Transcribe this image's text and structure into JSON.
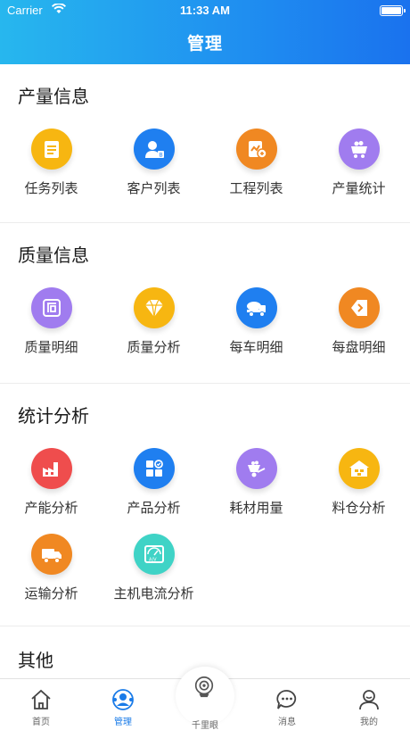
{
  "status_bar": {
    "carrier": "Carrier",
    "time": "11:33 AM"
  },
  "nav": {
    "title": "管理"
  },
  "sections": [
    {
      "title": "产量信息",
      "items": [
        {
          "label": "任务列表",
          "icon": "task-list-icon",
          "color": "#f7b611"
        },
        {
          "label": "客户列表",
          "icon": "customer-icon",
          "color": "#1f7ff0"
        },
        {
          "label": "工程列表",
          "icon": "project-list-icon",
          "color": "#f08822"
        },
        {
          "label": "产量统计",
          "icon": "cart-icon",
          "color": "#a07cef"
        }
      ]
    },
    {
      "title": "质量信息",
      "items": [
        {
          "label": "质量明细",
          "icon": "stamp-icon",
          "color": "#a07cef"
        },
        {
          "label": "质量分析",
          "icon": "diamond-icon",
          "color": "#f7b611"
        },
        {
          "label": "每车明细",
          "icon": "mixer-truck-icon",
          "color": "#1f7ff0"
        },
        {
          "label": "每盘明细",
          "icon": "tag-icon",
          "color": "#f08822"
        }
      ]
    },
    {
      "title": "统计分析",
      "items": [
        {
          "label": "产能分析",
          "icon": "factory-icon",
          "color": "#ef4d4d"
        },
        {
          "label": "产品分析",
          "icon": "grid-check-icon",
          "color": "#1f7ff0"
        },
        {
          "label": "耗材用量",
          "icon": "wheelbarrow-icon",
          "color": "#a07cef"
        },
        {
          "label": "料仓分析",
          "icon": "warehouse-icon",
          "color": "#f7b611"
        },
        {
          "label": "运输分析",
          "icon": "truck-icon",
          "color": "#f08822"
        },
        {
          "label": "主机电流分析",
          "icon": "ammeter-icon",
          "color": "#3fd3c6"
        }
      ]
    },
    {
      "title": "其他",
      "items": []
    }
  ],
  "tabbar": {
    "tabs": [
      {
        "label": "首页",
        "icon": "home-icon"
      },
      {
        "label": "管理",
        "icon": "manage-icon"
      },
      {
        "label": "千里眼",
        "icon": "camera-icon"
      },
      {
        "label": "消息",
        "icon": "message-icon"
      },
      {
        "label": "我的",
        "icon": "profile-icon"
      }
    ],
    "active_index": 1,
    "active_color": "#1a7be8"
  }
}
